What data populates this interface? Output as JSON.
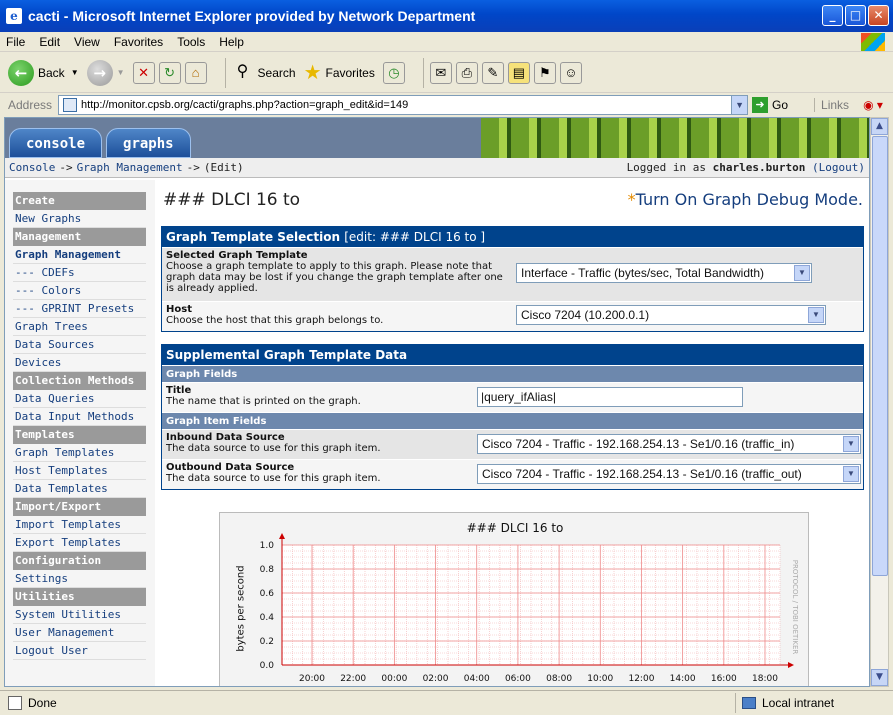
{
  "window": {
    "title": "cacti - Microsoft Internet Explorer provided by Network Department"
  },
  "menu": [
    "File",
    "Edit",
    "View",
    "Favorites",
    "Tools",
    "Help"
  ],
  "toolbar": {
    "back": "Back",
    "search": "Search",
    "favorites": "Favorites"
  },
  "address": {
    "label": "Address",
    "url": "http://monitor.cpsb.org/cacti/graphs.php?action=graph_edit&id=149",
    "go": "Go",
    "links": "Links"
  },
  "tabs": [
    "console",
    "graphs"
  ],
  "breadcrumb": {
    "items": [
      "Console",
      "Graph Management",
      "(Edit)"
    ],
    "separator": "->",
    "login_prefix": "Logged in as",
    "user": "charles.burton",
    "logout": "(Logout)"
  },
  "sidebar": [
    {
      "type": "header",
      "label": "Create"
    },
    {
      "type": "item",
      "label": "New Graphs"
    },
    {
      "type": "header",
      "label": "Management"
    },
    {
      "type": "item",
      "label": "Graph Management",
      "selected": true
    },
    {
      "type": "item",
      "label": "--- CDEFs"
    },
    {
      "type": "item",
      "label": "--- Colors"
    },
    {
      "type": "item",
      "label": "--- GPRINT Presets"
    },
    {
      "type": "item",
      "label": "Graph Trees"
    },
    {
      "type": "item",
      "label": "Data Sources"
    },
    {
      "type": "item",
      "label": "Devices"
    },
    {
      "type": "header",
      "label": "Collection Methods"
    },
    {
      "type": "item",
      "label": "Data Queries"
    },
    {
      "type": "item",
      "label": "Data Input Methods"
    },
    {
      "type": "header",
      "label": "Templates"
    },
    {
      "type": "item",
      "label": "Graph Templates"
    },
    {
      "type": "item",
      "label": "Host Templates"
    },
    {
      "type": "item",
      "label": "Data Templates"
    },
    {
      "type": "header",
      "label": "Import/Export"
    },
    {
      "type": "item",
      "label": "Import Templates"
    },
    {
      "type": "item",
      "label": "Export Templates"
    },
    {
      "type": "header",
      "label": "Configuration"
    },
    {
      "type": "item",
      "label": "Settings"
    },
    {
      "type": "header",
      "label": "Utilities"
    },
    {
      "type": "item",
      "label": "System Utilities"
    },
    {
      "type": "item",
      "label": "User Management"
    },
    {
      "type": "item",
      "label": "Logout User"
    }
  ],
  "page": {
    "title": "### DLCI 16 to",
    "debug_star": "*",
    "debug_link": "Turn On Graph Debug Mode."
  },
  "template_section": {
    "header": "Graph Template Selection",
    "header_edit": "[edit: ### DLCI 16 to ]",
    "template_label": "Selected Graph Template",
    "template_desc": "Choose a graph template to apply to this graph. Please note that graph data may be lost if you change the graph template after one is already applied.",
    "template_value": "Interface - Traffic (bytes/sec, Total Bandwidth)",
    "host_label": "Host",
    "host_desc": "Choose the host that this graph belongs to.",
    "host_value": "Cisco 7204 (10.200.0.1)"
  },
  "supplemental": {
    "header": "Supplemental Graph Template Data",
    "graph_fields": "Graph Fields",
    "title_label": "Title",
    "title_desc": "The name that is printed on the graph.",
    "title_value": "|query_ifAlias|",
    "item_fields": "Graph Item Fields",
    "inbound_label": "Inbound Data Source",
    "inbound_desc": "The data source to use for this graph item.",
    "inbound_value": "Cisco 7204 - Traffic - 192.168.254.13 - Se1/0.16 (traffic_in)",
    "outbound_label": "Outbound Data Source",
    "outbound_desc": "The data source to use for this graph item.",
    "outbound_value": "Cisco 7204 - Traffic - 192.168.254.13 - Se1/0.16 (traffic_out)"
  },
  "graph": {
    "watermark": "PROTOCOL / TOBI OETIKER"
  },
  "chart_data": {
    "type": "line",
    "title": "### DLCI 16 to",
    "ylabel": "bytes per second",
    "xlabel": "",
    "x_ticks": [
      "20:00",
      "22:00",
      "00:00",
      "02:00",
      "04:00",
      "06:00",
      "08:00",
      "10:00",
      "12:00",
      "14:00",
      "16:00",
      "18:00"
    ],
    "y_ticks": [
      "0.0",
      "0.2",
      "0.4",
      "0.6",
      "0.8",
      "1.0"
    ],
    "ylim": [
      0,
      1.0
    ],
    "grid": true,
    "series": [],
    "colors": {
      "grid": "#f2b4b4",
      "axis": "#cc0000"
    }
  },
  "status": {
    "text": "Done",
    "zone": "Local intranet"
  }
}
